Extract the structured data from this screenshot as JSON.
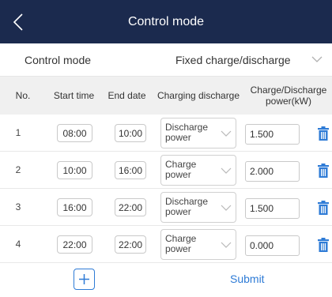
{
  "header": {
    "title": "Control mode",
    "back_icon": "chevron-left-icon"
  },
  "mode": {
    "label": "Control mode",
    "value": "Fixed charge/discharge",
    "icon": "chevron-down-icon"
  },
  "table": {
    "headers": [
      "No.",
      "Start time",
      "End date",
      "Charging discharge",
      "Charge/Discharge power(kW)"
    ],
    "rows": [
      {
        "no": "1",
        "start": "08:00",
        "end": "10:00",
        "mode_line1": "Discharge",
        "mode_line2": "power",
        "power": "1.500"
      },
      {
        "no": "2",
        "start": "10:00",
        "end": "16:00",
        "mode_line1": "Charge",
        "mode_line2": "power",
        "power": "2.000"
      },
      {
        "no": "3",
        "start": "16:00",
        "end": "22:00",
        "mode_line1": "Discharge",
        "mode_line2": "power",
        "power": "1.500"
      },
      {
        "no": "4",
        "start": "22:00",
        "end": "22:00",
        "mode_line1": "Charge",
        "mode_line2": "power",
        "power": "0.000"
      }
    ]
  },
  "footer": {
    "add_icon": "plus-icon",
    "submit_label": "Submit"
  },
  "colors": {
    "header_bg": "#1b2a4e",
    "accent": "#2e7bd6",
    "table_header_bg": "#f0f0f0"
  }
}
